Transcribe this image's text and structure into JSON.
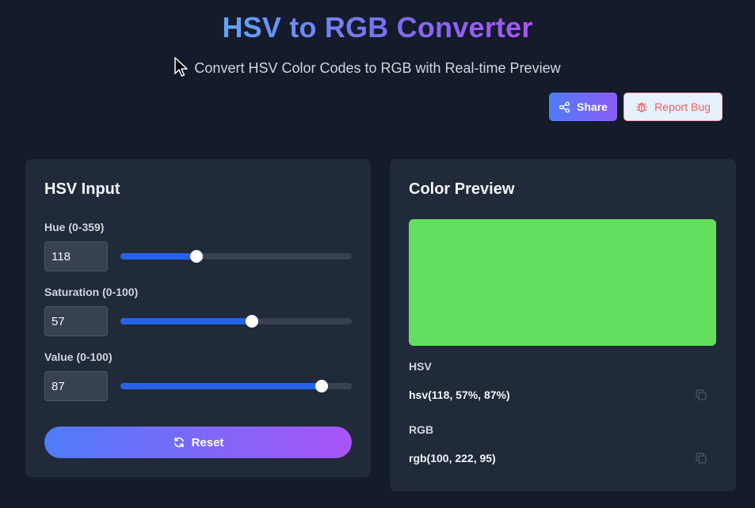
{
  "header": {
    "title": "HSV to RGB Converter",
    "subtitle": "Convert HSV Color Codes to RGB with Real-time Preview",
    "share_label": "Share",
    "report_label": "Report Bug"
  },
  "input_panel": {
    "title": "HSV Input",
    "fields": [
      {
        "label": "Hue (0-359)",
        "value": "118",
        "min": 0,
        "max": 359
      },
      {
        "label": "Saturation (0-100)",
        "value": "57",
        "min": 0,
        "max": 100
      },
      {
        "label": "Value (0-100)",
        "value": "87",
        "min": 0,
        "max": 100
      }
    ],
    "reset_label": "Reset"
  },
  "preview_panel": {
    "title": "Color Preview",
    "swatch_color": "#64de5f",
    "hsv_label": "HSV",
    "hsv_value": "hsv(118, 57%, 87%)",
    "rgb_label": "RGB",
    "rgb_value": "rgb(100, 222, 95)"
  },
  "colors": {
    "background": "#141b2b",
    "panel": "#212a3b",
    "accent": "#2563eb",
    "gradient_start": "#4f7cf7",
    "gradient_end": "#a855f7",
    "danger": "#ef6262"
  }
}
